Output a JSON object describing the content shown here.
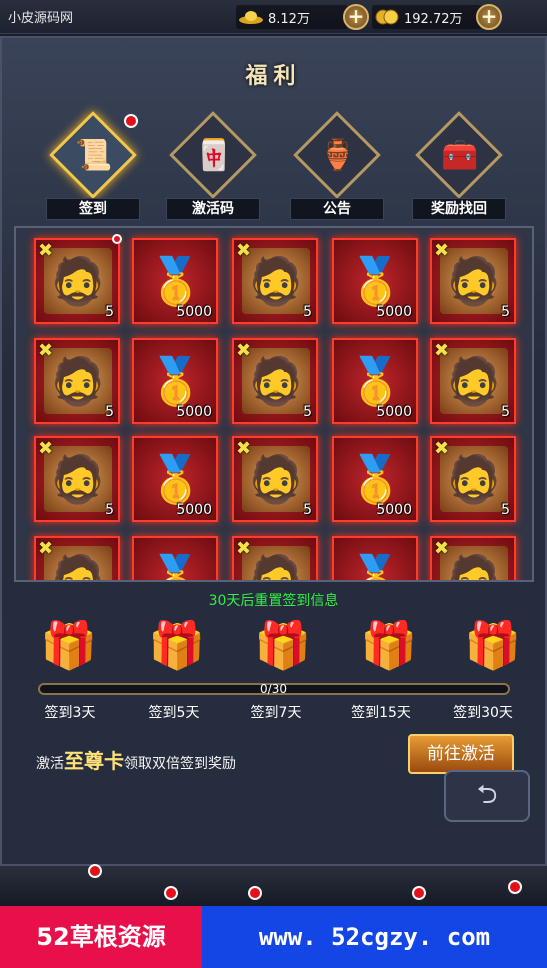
{
  "site_name": "小皮源码网",
  "resources": {
    "gold": "8.12万",
    "coins": "192.72万",
    "plus": "+"
  },
  "title": "福利",
  "tabs": [
    {
      "label": "签到",
      "icon": "📜"
    },
    {
      "label": "激活码",
      "icon": "🀄"
    },
    {
      "label": "公告",
      "icon": "🏺"
    },
    {
      "label": "奖励找回",
      "icon": "🧰"
    }
  ],
  "grid": {
    "hero_qty": "5",
    "gold_qty": "5000",
    "hero_icon": "🧔",
    "gold_icon": "🥇",
    "star": "✖"
  },
  "reset_text": "30天后重置签到信息",
  "chests": [
    {
      "label": "签到3天"
    },
    {
      "label": "签到5天"
    },
    {
      "label": "签到7天"
    },
    {
      "label": "签到15天"
    },
    {
      "label": "签到30天"
    }
  ],
  "chest_icon": "🎁",
  "progress": {
    "text": "0/30",
    "fraction": 0
  },
  "promo": {
    "prefix": "激活",
    "highlight": "至尊卡",
    "suffix": "领取双倍签到奖励"
  },
  "activate_button": "前往激活",
  "back_icon": "⮌",
  "banner": {
    "left": "52草根资源",
    "right": "www. 52cgzy. com"
  }
}
